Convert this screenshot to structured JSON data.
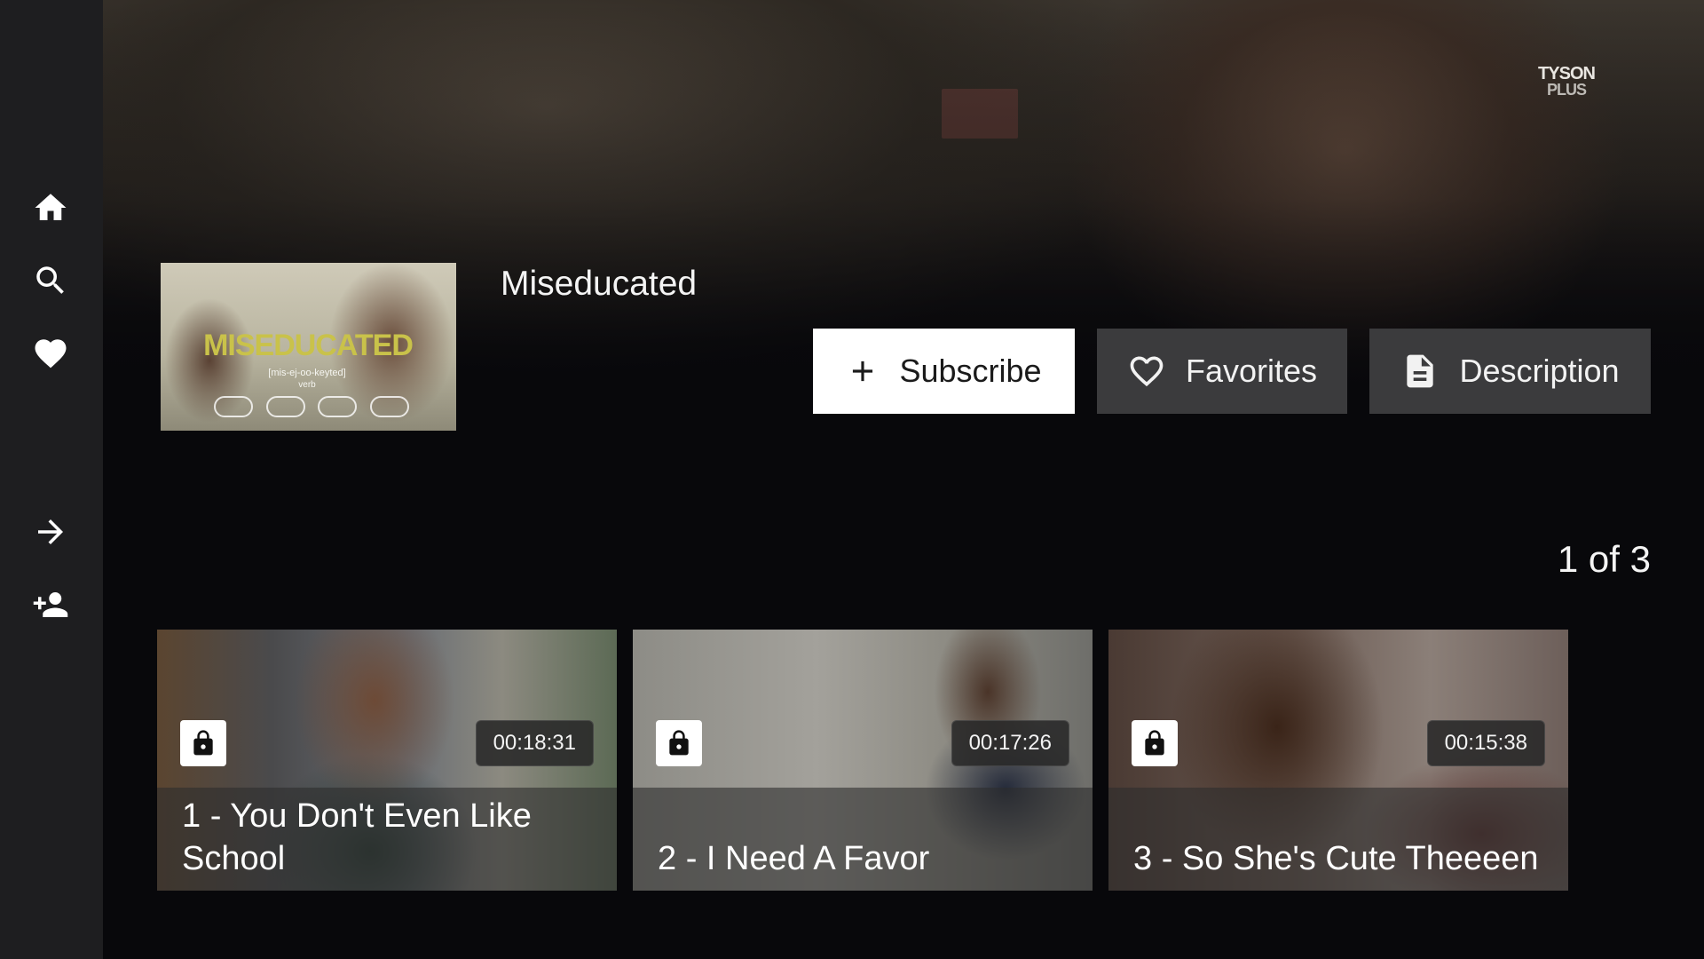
{
  "app": {
    "brand_line1": "TYSON",
    "brand_line2": "PLUS"
  },
  "sidebar": {
    "items": [
      {
        "icon": "home-icon"
      },
      {
        "icon": "search-icon"
      },
      {
        "icon": "heart-icon"
      },
      {
        "icon": "arrow-right-icon"
      },
      {
        "icon": "add-user-icon"
      }
    ]
  },
  "show": {
    "title": "Miseducated",
    "poster": {
      "title": "MISEDUCATED",
      "pronunciation": "[mis-ej-oo-keyted]",
      "part_of_speech": "verb"
    }
  },
  "actions": {
    "subscribe_label": "Subscribe",
    "favorites_label": "Favorites",
    "description_label": "Description"
  },
  "pager": {
    "text": "1 of 3"
  },
  "episodes": [
    {
      "title": "1 - You Don't Even Like School",
      "duration": "00:18:31",
      "locked": true
    },
    {
      "title": "2 - I Need A Favor",
      "duration": "00:17:26",
      "locked": true
    },
    {
      "title": "3 - So She's Cute Theeeen",
      "duration": "00:15:38",
      "locked": true
    }
  ],
  "colors": {
    "sidebar_bg": "#1e1e20",
    "page_bg": "#08080b",
    "button_primary_bg": "#ffffff",
    "button_secondary_bg": "#3b3b3d",
    "poster_title": "#c9c24a"
  }
}
